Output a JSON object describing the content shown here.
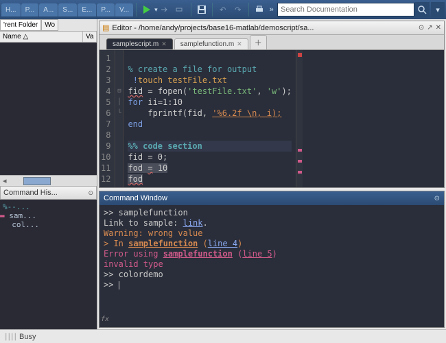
{
  "toolbar": {
    "tabs": [
      "H...",
      "P...",
      "A...",
      "S...",
      "E...",
      "P...",
      "V..."
    ],
    "search_placeholder": "Search Documentation"
  },
  "folder": {
    "tabs": [
      "'rent Folder",
      "Wo"
    ],
    "cols": [
      "Name △",
      "Va"
    ]
  },
  "history": {
    "title": "Command His...",
    "items": [
      {
        "txt": "%--...",
        "cls": "c1"
      },
      {
        "txt": "sam...",
        "cls": "err",
        "mark": true
      },
      {
        "txt": "col...",
        "cls": ""
      }
    ]
  },
  "editor": {
    "title": "Editor - /home/andy/projects/base16-matlab/demoscript/sa...",
    "tabs": [
      {
        "label": "samplescript.m",
        "active": true
      },
      {
        "label": "samplefunction.m",
        "active": false
      }
    ],
    "lines": [
      "1",
      "2",
      "3",
      "4",
      "5",
      "6",
      "7",
      "8",
      "9",
      "10",
      "11",
      "12"
    ],
    "code": {
      "l1": "% create a file for output",
      "l2_a": "!",
      "l2_b": "touch testFile.txt",
      "l3_a": "fid",
      "l3_b": " = fopen(",
      "l3_c": "'testFile.txt'",
      "l3_d": ", ",
      "l3_e": "'w'",
      "l3_f": ");",
      "l4_a": "for",
      "l4_b": " ii=1:10",
      "l5_a": "    fprintf(fid, ",
      "l5_b": "'%6.2f \\n, i);",
      "l6": "end",
      "l8": "%% code section",
      "l9": "fid = 0;",
      "l10_a": "fod ",
      "l10_b": "=",
      "l10_c": " 10",
      "l11": "fod"
    }
  },
  "cmd": {
    "title": "Command Window",
    "l1": ">> samplefunction",
    "l2_a": "Link to sample: ",
    "l2_b": "link",
    "l2_c": ".",
    "l3": "Warning: wrong value",
    "l4_a": "> In ",
    "l4_b": "samplefunction",
    "l4_c": " (",
    "l4_d": "line 4",
    "l4_e": ")",
    "l5_a": "Error using ",
    "l5_b": "samplefunction",
    "l5_c": " (",
    "l5_d": "line 5",
    "l5_e": ")",
    "l6": "invalid type",
    "l7": ">> colordemo",
    "prompt": ">> "
  },
  "status": {
    "text": "Busy"
  }
}
